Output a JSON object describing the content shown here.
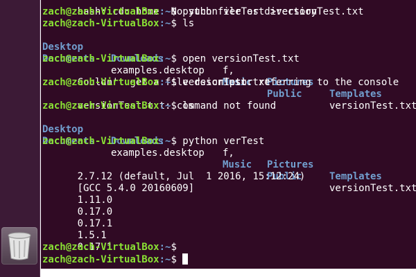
{
  "launcher": {
    "trash_icon": "trash-icon"
  },
  "terminal": {
    "prompt_user": "zach@zach-VirtualBox",
    "prompt_path": ":~",
    "prompt_symbol": "$ ",
    "lines": {
      "l0": "bash: cd: home: No such file or directory",
      "l1_cmd": "python verTest >versionTest.txt",
      "l2_cmd": "ls",
      "ls1": {
        "desktop": "Desktop",
        "downloads": "Downloads",
        "f": "f,",
        "pictures": "Pictures",
        "templates": "Templates",
        "documents": "Documents",
        "examples": "examples.desktop",
        "music": "Music",
        "public": "Public",
        "versiontest": "versionTest.txt"
      },
      "l5_cmd": "open versionTest.txt",
      "l6": "Couldn't get a file descriptor referring to the console",
      "l7_cmd": "versionTest.txt",
      "l8": "versionTest.txt: command not found",
      "l9_cmd": "ls",
      "ls2": {
        "desktop": "Desktop",
        "downloads": "Downloads",
        "f": "f,",
        "pictures": "Pictures",
        "templates": "Templates",
        "documents": "Documents",
        "examples": "examples.desktop",
        "music": "Music",
        "public": "Public",
        "versiontest": "versionTest.txt"
      },
      "l12_cmd": "python verTest",
      "l14": "2.7.12 (default, Jul  1 2016, 15:12:24)",
      "l15": "[GCC 5.4.0 20160609]",
      "l16": "1.11.0",
      "l17": "0.17.0",
      "l18": "0.17.1",
      "l19": "1.5.1",
      "l20": "0.17.1"
    }
  },
  "colors": {
    "terminal_bg": "#300a24",
    "prompt_user": "#8ae234",
    "prompt_path": "#729fcf",
    "directory": "#729fcf",
    "text": "#ffffff",
    "launcher_bg": "#3c1a36"
  }
}
